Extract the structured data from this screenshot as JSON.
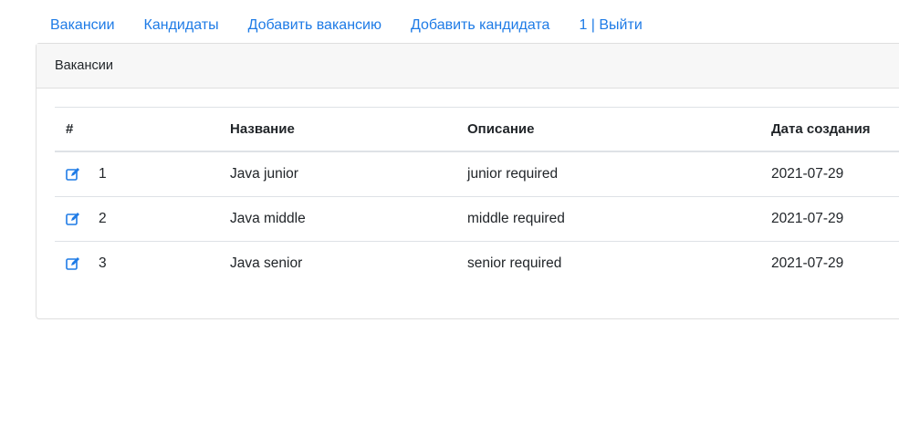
{
  "nav": {
    "items": [
      {
        "label": "Вакансии"
      },
      {
        "label": "Кандидаты"
      },
      {
        "label": "Добавить вакансию"
      },
      {
        "label": "Добавить кандидата"
      },
      {
        "label": "1 | Выйти"
      }
    ]
  },
  "card": {
    "title": "Вакансии"
  },
  "table": {
    "headers": [
      "#",
      "Название",
      "Описание",
      "Дата создания"
    ],
    "rows": [
      {
        "id": "1",
        "name": "Java junior",
        "description": "junior required",
        "created": "2021-07-29",
        "icon": "edit-icon"
      },
      {
        "id": "2",
        "name": "Java middle",
        "description": "middle required",
        "created": "2021-07-29",
        "icon": "edit-icon"
      },
      {
        "id": "3",
        "name": "Java senior",
        "description": "senior required",
        "created": "2021-07-29",
        "icon": "edit-icon"
      }
    ]
  },
  "colors": {
    "link": "#1e7be6",
    "text": "#212529",
    "header_bg": "#f7f7f7",
    "border": "#dee2e6"
  }
}
